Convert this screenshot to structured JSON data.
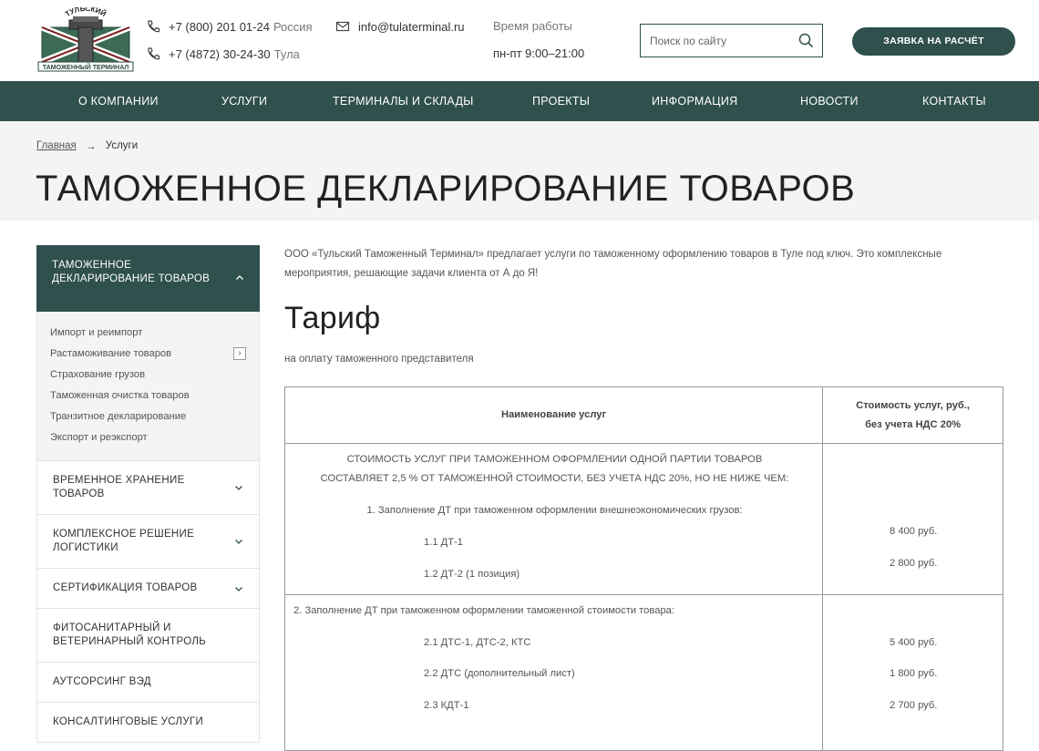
{
  "header": {
    "logo_text_top": "ТУЛЬСКИЙ",
    "logo_text_bottom": "ТАМОЖЕННЫЙ ТЕРМИНАЛ",
    "phone_1": "+7 (800) 201 01-24",
    "phone_1_region": "Россия",
    "phone_2": "+7 (4872) 30-24-30",
    "phone_2_region": "Тула",
    "email": "info@tulaterminal.ru",
    "work_label": "Время работы",
    "work_hours": "пн-пт 9:00–21:00",
    "search_placeholder": "Поиск по сайту",
    "cta_label": "ЗАЯВКА НА РАСЧЁТ"
  },
  "colors": {
    "brand": "#2f504c",
    "band": "#f4f4f4"
  },
  "nav": [
    "О КОМПАНИИ",
    "УСЛУГИ",
    "ТЕРМИНАЛЫ И СКЛАДЫ",
    "ПРОЕКТЫ",
    "ИНФОРМАЦИЯ",
    "НОВОСТИ",
    "КОНТАКТЫ"
  ],
  "breadcrumb": {
    "home": "Главная",
    "current": "Услуги"
  },
  "page_title": "ТАМОЖЕННОЕ ДЕКЛАРИРОВАНИЕ ТОВАРОВ",
  "sidebar": {
    "active": "ТАМОЖЕННОЕ ДЕКЛАРИРОВАНИЕ ТОВАРОВ",
    "subitems": [
      "Импорт и реимпорт",
      "Растаможивание товаров",
      "Страхование грузов",
      "Таможенная очистка товаров",
      "Транзитное декларирование",
      "Экспорт и реэкспорт"
    ],
    "items": [
      "ВРЕМЕННОЕ ХРАНЕНИЕ ТОВАРОВ",
      "КОМПЛЕКСНОЕ РЕШЕНИЕ ЛОГИСТИКИ",
      "СЕРТИФИКАЦИЯ ТОВАРОВ",
      "ФИТОСАНИТАРНЫЙ И ВЕТЕРИНАРНЫЙ КОНТРОЛЬ",
      "АУТСОРСИНГ ВЭД",
      "КОНСАЛТИНГОВЫЕ УСЛУГИ"
    ]
  },
  "content": {
    "intro": "ООО «Тульский Таможенный Терминал» предлагает услуги по таможенному оформлению товаров в Туле под ключ. Это комплексные мероприятия, решающие задачи клиента от А до Я!",
    "tariff_title": "Тариф",
    "tariff_subtitle": "на оплату таможенного представителя"
  },
  "table": {
    "header_service": "Наименование услуг",
    "header_price_1": "Стоимость услуг, руб.,",
    "header_price_2": "без учета НДС 20%",
    "block1": {
      "caption_1": "СТОИМОСТЬ УСЛУГ ПРИ ТАМОЖЕННОМ ОФОРМЛЕНИИ ОДНОЙ ПАРТИИ ТОВАРОВ",
      "caption_2": "СОСТАВЛЯЕТ 2,5 % ОТ ТАМОЖЕННОЙ СТОИМОСТИ, БЕЗ УЧЕТА НДС 20%, НО НЕ НИЖЕ ЧЕМ:",
      "section": "1. Заполнение ДТ при таможенном оформлении внешнеэкономических грузов:",
      "row1_name": "1.1 ДТ-1",
      "row1_price": "8 400 руб.",
      "row2_name": "1.2 ДТ-2 (1 позиция)",
      "row2_price": "2 800 руб."
    },
    "block2": {
      "section": "2. Заполнение ДТ при таможенном оформлении таможенной стоимости товара:",
      "row1_name": "2.1 ДТС-1, ДТС-2, КТС",
      "row1_price": "5 400 руб.",
      "row2_name": "2.2 ДТС (дополнительный лист)",
      "row2_price": "1 800 руб.",
      "row3_name": "2.3 КДТ-1",
      "row3_price": "2 700 руб."
    }
  }
}
